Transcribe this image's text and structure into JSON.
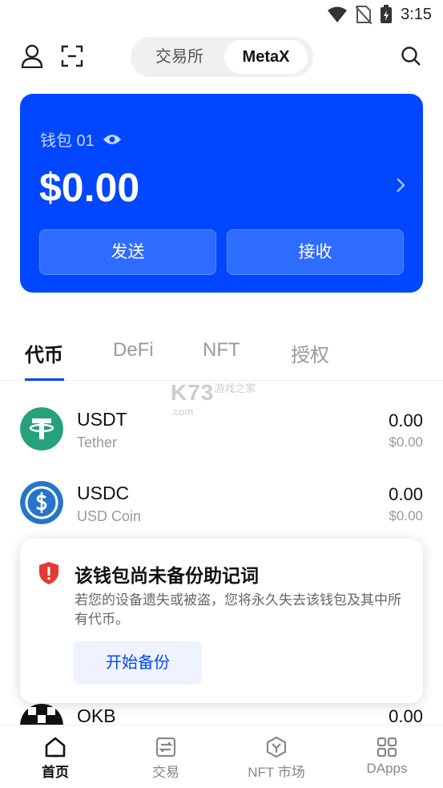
{
  "status_bar": {
    "time": "3:15"
  },
  "header": {
    "segment_exchange": "交易所",
    "segment_metax": "MetaX"
  },
  "wallet_card": {
    "wallet_name": "钱包 01",
    "balance": "$0.00",
    "send_label": "发送",
    "receive_label": "接收"
  },
  "tabs": [
    {
      "label": "代币",
      "active": true
    },
    {
      "label": "DeFi",
      "active": false
    },
    {
      "label": "NFT",
      "active": false
    },
    {
      "label": "授权",
      "active": false
    }
  ],
  "watermark": {
    "main": "K73",
    "sub": "游戏之家",
    "domain": ".com"
  },
  "tokens": [
    {
      "symbol": "USDT",
      "name": "Tether",
      "amount": "0.00",
      "usd": "$0.00",
      "icon": "usdt-logo"
    },
    {
      "symbol": "USDC",
      "name": "USD Coin",
      "amount": "0.00",
      "usd": "$0.00",
      "icon": "usdc-logo"
    },
    {
      "symbol": "OKB",
      "amount": "0.00",
      "icon": "okb-logo"
    }
  ],
  "backup_popup": {
    "title": "该钱包尚未备份助记词",
    "body": "若您的设备遗失或被盗，您将永久失去该钱包及其中所有代币。",
    "button": "开始备份"
  },
  "bottom_nav": [
    {
      "label": "首页",
      "icon": "home-icon",
      "active": true
    },
    {
      "label": "交易",
      "icon": "swap-icon",
      "active": false
    },
    {
      "label": "NFT 市场",
      "icon": "nft-market-icon",
      "active": false
    },
    {
      "label": "DApps",
      "icon": "dapps-icon",
      "active": false
    }
  ],
  "colors": {
    "primary": "#0047ff",
    "usdt": "#26a17b",
    "usdc": "#2775ca",
    "warning": "#e53935"
  }
}
